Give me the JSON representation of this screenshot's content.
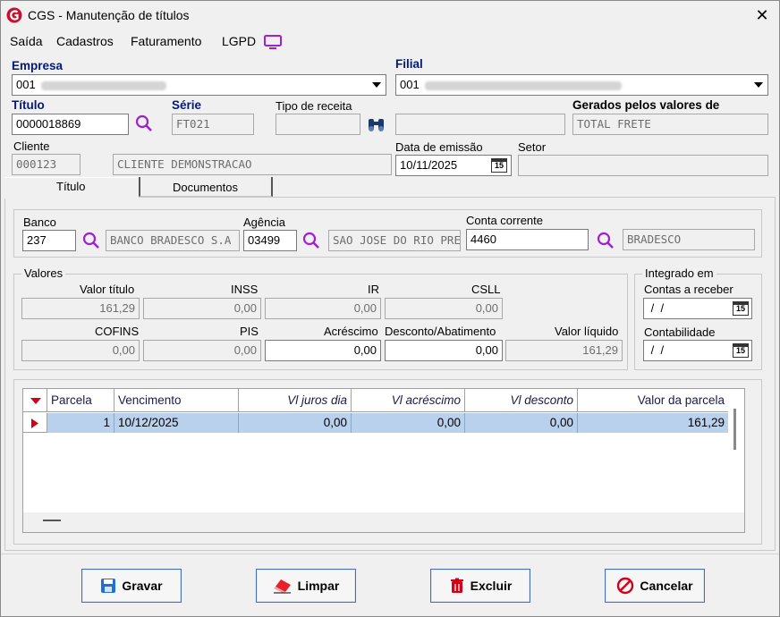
{
  "window": {
    "title": "CGS - Manutenção de títulos",
    "close": "✕"
  },
  "menu": [
    "Saída",
    "Cadastros",
    "Faturamento",
    "LGPD"
  ],
  "header": {
    "empresa_label": "Empresa",
    "empresa_code": "001",
    "filial_label": "Filial",
    "filial_code": "001",
    "titulo_label": "Título",
    "titulo_value": "0000018869",
    "serie_label": "Série",
    "serie_value": "FT021",
    "tipo_receita_label": "Tipo de receita",
    "tipo_receita_value": "",
    "gerados_label": "Gerados pelos valores de",
    "gerados_value": "TOTAL FRETE",
    "cliente_label": "Cliente",
    "cliente_code": "000123",
    "cliente_name": "CLIENTE DEMONSTRACAO",
    "data_emissao_label": "Data de emissão",
    "data_emissao_value": "10/11/2025",
    "setor_label": "Setor",
    "setor_value": ""
  },
  "tabs": [
    "Título",
    "Documentos"
  ],
  "bank": {
    "banco_label": "Banco",
    "banco_code": "237",
    "banco_name": "BANCO BRADESCO S.A",
    "agencia_label": "Agência",
    "agencia_code": "03499",
    "agencia_name": "SAO JOSE DO RIO PRE",
    "conta_label": "Conta corrente",
    "conta_value": "4460",
    "conta_name": "BRADESCO"
  },
  "valores": {
    "title": "Valores",
    "valor_titulo_label": "Valor título",
    "valor_titulo": "161,29",
    "inss_label": "INSS",
    "inss": "0,00",
    "ir_label": "IR",
    "ir": "0,00",
    "csll_label": "CSLL",
    "csll": "0,00",
    "cofins_label": "COFINS",
    "cofins": "0,00",
    "pis_label": "PIS",
    "pis": "0,00",
    "acrescimo_label": "Acréscimo",
    "acrescimo": "0,00",
    "desconto_label": "Desconto/Abatimento",
    "desconto": "0,00",
    "liquido_label": "Valor líquido",
    "liquido": "161,29"
  },
  "integrado": {
    "title": "Integrado em",
    "contas_label": "Contas a receber",
    "contas_value": " /  /",
    "contab_label": "Contabilidade",
    "contab_value": " /  /",
    "cal_badge": "15"
  },
  "grid": {
    "headers": [
      "Parcela",
      "Vencimento",
      "Vl juros dia",
      "Vl acréscimo",
      "Vl desconto",
      "Valor da parcela"
    ],
    "rows": [
      {
        "parcela": "1",
        "vencimento": "10/12/2025",
        "juros": "0,00",
        "acrescimo": "0,00",
        "desconto": "0,00",
        "valor": "161,29"
      }
    ]
  },
  "buttons": {
    "gravar": "Gravar",
    "limpar": "Limpar",
    "excluir": "Excluir",
    "cancelar": "Cancelar"
  },
  "colors": {
    "label_blue": "#001a80",
    "selection": "#b9d1ec",
    "accent_red": "#d0021b",
    "lgpd_purple": "#a020d0"
  }
}
